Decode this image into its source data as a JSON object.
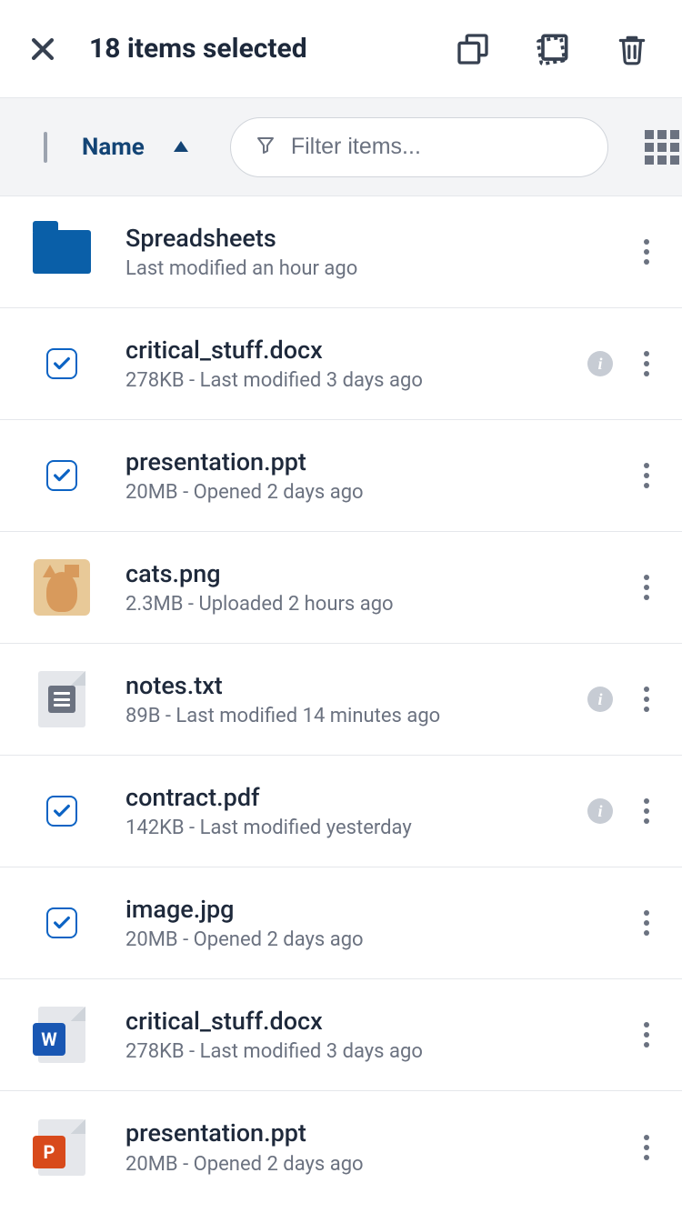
{
  "header": {
    "title": "18 items selected"
  },
  "toolbar": {
    "sort_label": "Name",
    "filter_placeholder": "Filter items..."
  },
  "items": [
    {
      "type": "folder",
      "name": "Spreadsheets",
      "sub": "Last modified an hour ago",
      "selected": false,
      "show_info": false
    },
    {
      "type": "checked",
      "name": "critical_stuff.docx",
      "sub": "278KB - Last modified 3 days ago",
      "selected": true,
      "show_info": true
    },
    {
      "type": "checked",
      "name": "presentation.ppt",
      "sub": "20MB - Opened 2 days ago",
      "selected": true,
      "show_info": false
    },
    {
      "type": "image-cat",
      "name": "cats.png",
      "sub": "2.3MB - Uploaded 2 hours ago",
      "selected": false,
      "show_info": false
    },
    {
      "type": "text",
      "name": "notes.txt",
      "sub": "89B - Last modified 14 minutes ago",
      "selected": false,
      "show_info": true
    },
    {
      "type": "checked",
      "name": "contract.pdf",
      "sub": "142KB - Last modified yesterday",
      "selected": true,
      "show_info": true
    },
    {
      "type": "checked",
      "name": "image.jpg",
      "sub": "20MB - Opened 2 days ago",
      "selected": true,
      "show_info": false
    },
    {
      "type": "word",
      "name": "critical_stuff.docx",
      "sub": "278KB - Last modified 3 days ago",
      "selected": false,
      "show_info": false
    },
    {
      "type": "ppt",
      "name": "presentation.ppt",
      "sub": "20MB - Opened 2 days ago",
      "selected": false,
      "show_info": false
    }
  ]
}
